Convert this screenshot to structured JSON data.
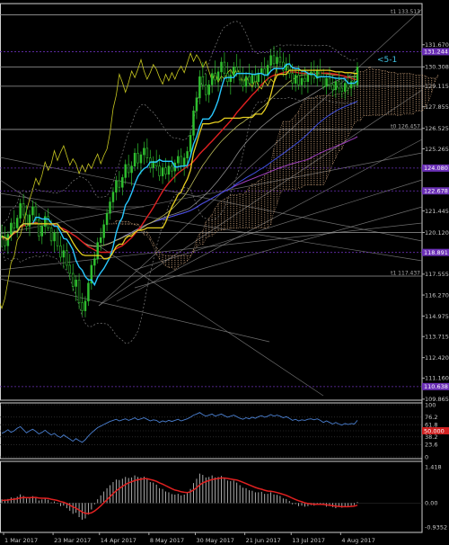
{
  "chart_data": [
    {
      "type": "candlestick",
      "panel": "price",
      "title": "",
      "ylim": [
        109.8,
        134.2
      ],
      "y_ticks": [
        131.67,
        130.308,
        129.115,
        127.855,
        126.525,
        125.265,
        124.005,
        122.775,
        121.445,
        120.12,
        118.825,
        117.555,
        116.27,
        114.975,
        113.715,
        112.42,
        111.16,
        109.865
      ],
      "highlighted_levels": [
        {
          "value": 131.244,
          "label": "131.244",
          "color": "#6a2fb5"
        },
        {
          "value": 124.08,
          "label": "124.080",
          "color": "#6a2fb5"
        },
        {
          "value": 122.678,
          "label": "122.678",
          "color": "#6a2fb5"
        },
        {
          "value": 118.891,
          "label": "118.891",
          "color": "#6a2fb5"
        },
        {
          "value": 110.638,
          "label": "110.638",
          "color": "#6a2fb5"
        }
      ],
      "level_lines": [
        {
          "value": 133.513,
          "label": "t1 133.513"
        },
        {
          "value": 126.457,
          "label": "t0 126.457"
        },
        {
          "value": 117.437,
          "label": "t1 117.437"
        },
        {
          "value": 130.308,
          "label": ""
        },
        {
          "value": 129.115,
          "label": ""
        },
        {
          "value": 120.12,
          "label": ""
        }
      ],
      "annotation": "<5-1",
      "x_labels": [
        "1 Mar 2017",
        "23 Mar 2017",
        "14 Apr 2017",
        "8 May 2017",
        "30 May 2017",
        "21 Jun 2017",
        "13 Jul 2017",
        "4 Aug 2017"
      ],
      "bar_count": 116,
      "candles_ohlc": [
        [
          119.8,
          120.6,
          119.2,
          119.9
        ],
        [
          119.9,
          120.5,
          119.0,
          119.3
        ],
        [
          119.3,
          120.2,
          118.8,
          120.0
        ],
        [
          120.0,
          121.0,
          119.6,
          120.7
        ],
        [
          120.7,
          121.5,
          120.2,
          120.4
        ],
        [
          120.4,
          121.2,
          119.8,
          121.0
        ],
        [
          121.0,
          122.2,
          120.7,
          121.9
        ],
        [
          121.9,
          122.5,
          121.0,
          121.2
        ],
        [
          121.2,
          121.8,
          120.2,
          120.5
        ],
        [
          120.5,
          121.5,
          119.9,
          121.2
        ],
        [
          121.2,
          122.1,
          120.8,
          121.7
        ],
        [
          121.7,
          122.0,
          120.6,
          120.9
        ],
        [
          120.9,
          121.3,
          119.6,
          119.9
        ],
        [
          119.9,
          120.8,
          119.4,
          120.5
        ],
        [
          120.5,
          121.4,
          120.0,
          121.1
        ],
        [
          121.1,
          121.6,
          120.2,
          120.4
        ],
        [
          120.4,
          120.9,
          119.3,
          119.6
        ],
        [
          119.6,
          120.3,
          118.9,
          120.1
        ],
        [
          120.1,
          120.6,
          119.0,
          119.3
        ],
        [
          119.3,
          119.9,
          118.3,
          118.6
        ],
        [
          118.6,
          119.4,
          117.9,
          119.0
        ],
        [
          119.0,
          119.5,
          117.8,
          118.1
        ],
        [
          118.1,
          118.8,
          117.2,
          117.6
        ],
        [
          117.6,
          118.2,
          116.5,
          116.8
        ],
        [
          116.8,
          117.5,
          115.9,
          117.2
        ],
        [
          117.2,
          117.6,
          115.4,
          115.8
        ],
        [
          115.8,
          116.4,
          115.0,
          115.3
        ],
        [
          115.3,
          116.2,
          114.9,
          115.9
        ],
        [
          115.9,
          117.3,
          115.6,
          117.0
        ],
        [
          117.0,
          118.4,
          116.6,
          118.1
        ],
        [
          118.1,
          118.9,
          117.5,
          118.5
        ],
        [
          118.5,
          119.8,
          118.2,
          119.5
        ],
        [
          119.5,
          120.4,
          119.0,
          119.8
        ],
        [
          119.8,
          120.9,
          119.3,
          120.6
        ],
        [
          120.6,
          121.6,
          120.2,
          121.3
        ],
        [
          121.3,
          122.3,
          120.9,
          122.0
        ],
        [
          122.0,
          122.9,
          121.5,
          122.6
        ],
        [
          122.6,
          123.6,
          122.1,
          123.3
        ],
        [
          123.3,
          123.9,
          122.6,
          122.9
        ],
        [
          122.9,
          123.7,
          122.4,
          123.5
        ],
        [
          123.5,
          124.6,
          123.1,
          124.3
        ],
        [
          124.3,
          124.9,
          123.5,
          123.8
        ],
        [
          123.8,
          124.5,
          123.0,
          124.2
        ],
        [
          124.2,
          125.3,
          123.9,
          125.0
        ],
        [
          125.0,
          125.6,
          124.0,
          124.4
        ],
        [
          124.4,
          125.1,
          123.7,
          124.9
        ],
        [
          124.9,
          125.7,
          124.3,
          125.3
        ],
        [
          125.3,
          125.9,
          124.4,
          124.7
        ],
        [
          124.7,
          125.2,
          123.8,
          124.1
        ],
        [
          124.1,
          124.8,
          123.5,
          124.5
        ],
        [
          124.5,
          125.2,
          123.9,
          124.2
        ],
        [
          124.2,
          124.9,
          123.3,
          123.6
        ],
        [
          123.6,
          124.4,
          123.1,
          124.1
        ],
        [
          124.1,
          124.7,
          123.4,
          123.7
        ],
        [
          123.7,
          124.5,
          123.2,
          124.2
        ],
        [
          124.2,
          124.8,
          123.5,
          123.9
        ],
        [
          123.9,
          124.6,
          123.2,
          124.4
        ],
        [
          124.4,
          125.2,
          123.9,
          124.8
        ],
        [
          124.8,
          125.3,
          123.9,
          124.2
        ],
        [
          124.2,
          125.0,
          123.6,
          124.7
        ],
        [
          124.7,
          125.4,
          124.1,
          125.1
        ],
        [
          125.1,
          126.4,
          124.8,
          126.1
        ],
        [
          126.1,
          127.9,
          125.8,
          127.6
        ],
        [
          127.6,
          128.8,
          127.1,
          128.4
        ],
        [
          128.4,
          130.1,
          128.0,
          129.7
        ],
        [
          129.7,
          130.6,
          128.9,
          129.2
        ],
        [
          129.2,
          129.9,
          128.2,
          128.6
        ],
        [
          128.6,
          129.5,
          128.1,
          129.2
        ],
        [
          129.2,
          130.2,
          128.7,
          129.9
        ],
        [
          129.9,
          130.7,
          129.2,
          129.5
        ],
        [
          129.5,
          130.3,
          128.8,
          130.0
        ],
        [
          130.0,
          130.9,
          129.4,
          130.6
        ],
        [
          130.6,
          131.2,
          129.6,
          129.9
        ],
        [
          129.9,
          130.6,
          129.1,
          129.4
        ],
        [
          129.4,
          130.2,
          128.6,
          129.8
        ],
        [
          129.8,
          130.6,
          129.3,
          130.3
        ],
        [
          130.3,
          131.1,
          129.7,
          130.0
        ],
        [
          130.0,
          130.8,
          129.2,
          129.5
        ],
        [
          129.5,
          130.3,
          128.8,
          129.1
        ],
        [
          129.1,
          130.0,
          128.7,
          129.7
        ],
        [
          129.7,
          130.5,
          129.1,
          129.3
        ],
        [
          129.3,
          130.1,
          128.8,
          129.8
        ],
        [
          129.8,
          130.4,
          129.0,
          129.4
        ],
        [
          129.4,
          130.2,
          128.8,
          129.9
        ],
        [
          129.9,
          130.6,
          129.3,
          130.2
        ],
        [
          130.2,
          130.9,
          129.5,
          129.8
        ],
        [
          129.8,
          130.7,
          129.4,
          130.4
        ],
        [
          130.4,
          131.4,
          130.0,
          131.0
        ],
        [
          131.0,
          131.6,
          130.2,
          130.5
        ],
        [
          130.5,
          131.3,
          129.9,
          130.9
        ],
        [
          130.9,
          131.5,
          130.3,
          130.6
        ],
        [
          130.6,
          131.2,
          129.7,
          130.1
        ],
        [
          130.1,
          130.9,
          129.5,
          130.5
        ],
        [
          130.5,
          131.1,
          129.6,
          129.9
        ],
        [
          129.9,
          130.5,
          128.9,
          129.3
        ],
        [
          129.3,
          130.2,
          128.8,
          129.8
        ],
        [
          129.8,
          130.4,
          128.9,
          129.2
        ],
        [
          129.2,
          130.0,
          128.6,
          129.6
        ],
        [
          129.6,
          130.3,
          129.0,
          129.4
        ],
        [
          129.4,
          130.1,
          128.7,
          129.8
        ],
        [
          129.8,
          130.6,
          129.2,
          130.0
        ],
        [
          130.0,
          130.7,
          129.3,
          129.6
        ],
        [
          129.6,
          130.4,
          129.1,
          130.1
        ],
        [
          130.1,
          130.8,
          129.4,
          129.7
        ],
        [
          129.7,
          130.2,
          128.9,
          129.1
        ],
        [
          129.1,
          129.9,
          128.6,
          129.6
        ],
        [
          129.6,
          130.3,
          128.9,
          129.2
        ],
        [
          129.2,
          129.8,
          128.5,
          128.9
        ],
        [
          128.9,
          129.7,
          128.4,
          129.4
        ],
        [
          129.4,
          130.0,
          128.7,
          129.0
        ],
        [
          129.0,
          129.6,
          128.4,
          128.8
        ],
        [
          128.8,
          129.5,
          128.3,
          129.3
        ],
        [
          129.3,
          129.9,
          128.6,
          129.0
        ],
        [
          129.0,
          129.7,
          128.5,
          129.4
        ],
        [
          129.4,
          130.0,
          128.9,
          129.2
        ],
        [
          129.2,
          130.6,
          129.0,
          130.3
        ]
      ]
    },
    {
      "type": "line",
      "panel": "oscillator",
      "ylim": [
        0,
        100
      ],
      "y_ticks": [
        100,
        76.2,
        61.8,
        50,
        38.2,
        23.6,
        0
      ],
      "current_value_label": "50.000",
      "series": [
        {
          "color": "#4a7fd0",
          "values": [
            45,
            48,
            52,
            47,
            50,
            55,
            58,
            52,
            46,
            50,
            53,
            49,
            44,
            47,
            51,
            46,
            42,
            45,
            40,
            37,
            42,
            38,
            34,
            30,
            35,
            31,
            28,
            33,
            40,
            46,
            51,
            56,
            59,
            62,
            65,
            68,
            70,
            72,
            69,
            71,
            73,
            70,
            72,
            75,
            71,
            73,
            75,
            72,
            69,
            71,
            70,
            66,
            69,
            67,
            70,
            68,
            70,
            72,
            69,
            71,
            73,
            76,
            80,
            82,
            85,
            81,
            78,
            80,
            82,
            78,
            80,
            82,
            79,
            76,
            78,
            80,
            77,
            74,
            72,
            75,
            73,
            76,
            74,
            77,
            79,
            76,
            78,
            81,
            78,
            80,
            78,
            75,
            77,
            74,
            70,
            72,
            69,
            71,
            70,
            72,
            73,
            71,
            73,
            70,
            66,
            69,
            66,
            63,
            66,
            63,
            61,
            64,
            62,
            64,
            63,
            70
          ]
        }
      ]
    },
    {
      "type": "macd",
      "panel": "histogram",
      "y_ticks": [
        1.418,
        0.0,
        -0.9352
      ],
      "histogram": [
        0.15,
        0.14,
        0.16,
        0.22,
        0.2,
        0.25,
        0.34,
        0.28,
        0.18,
        0.22,
        0.27,
        0.21,
        0.1,
        0.14,
        0.2,
        0.13,
        0.03,
        0.06,
        -0.02,
        -0.12,
        -0.1,
        -0.2,
        -0.3,
        -0.42,
        -0.38,
        -0.55,
        -0.65,
        -0.6,
        -0.45,
        -0.25,
        -0.05,
        0.15,
        0.3,
        0.45,
        0.58,
        0.7,
        0.82,
        0.92,
        0.9,
        0.95,
        1.02,
        0.98,
        1.0,
        1.08,
        1.02,
        1.0,
        1.03,
        0.95,
        0.82,
        0.8,
        0.72,
        0.58,
        0.55,
        0.45,
        0.42,
        0.35,
        0.33,
        0.36,
        0.3,
        0.33,
        0.4,
        0.55,
        0.78,
        0.95,
        1.15,
        1.1,
        1.0,
        1.02,
        1.08,
        1.0,
        1.02,
        1.06,
        0.98,
        0.88,
        0.86,
        0.88,
        0.8,
        0.7,
        0.6,
        0.58,
        0.5,
        0.48,
        0.42,
        0.42,
        0.44,
        0.36,
        0.36,
        0.42,
        0.34,
        0.32,
        0.28,
        0.18,
        0.16,
        0.08,
        -0.05,
        -0.04,
        -0.12,
        -0.1,
        -0.14,
        -0.12,
        -0.08,
        -0.1,
        -0.06,
        -0.04,
        -0.08,
        -0.14,
        -0.12,
        -0.16,
        -0.2,
        -0.14,
        -0.18,
        -0.16,
        -0.12,
        -0.1,
        -0.08,
        0.04
      ],
      "signal": [
        0.1,
        0.11,
        0.12,
        0.14,
        0.15,
        0.17,
        0.2,
        0.22,
        0.21,
        0.21,
        0.22,
        0.22,
        0.2,
        0.19,
        0.19,
        0.18,
        0.15,
        0.13,
        0.1,
        0.06,
        0.03,
        -0.02,
        -0.08,
        -0.15,
        -0.2,
        -0.27,
        -0.35,
        -0.4,
        -0.41,
        -0.38,
        -0.31,
        -0.22,
        -0.11,
        0.01,
        0.13,
        0.25,
        0.37,
        0.48,
        0.57,
        0.65,
        0.73,
        0.79,
        0.83,
        0.88,
        0.91,
        0.93,
        0.95,
        0.95,
        0.92,
        0.89,
        0.85,
        0.79,
        0.74,
        0.68,
        0.62,
        0.56,
        0.51,
        0.48,
        0.44,
        0.42,
        0.41,
        0.44,
        0.51,
        0.6,
        0.71,
        0.79,
        0.84,
        0.88,
        0.92,
        0.94,
        0.96,
        0.98,
        0.98,
        0.96,
        0.94,
        0.92,
        0.9,
        0.86,
        0.81,
        0.76,
        0.71,
        0.66,
        0.61,
        0.57,
        0.54,
        0.5,
        0.47,
        0.46,
        0.44,
        0.41,
        0.38,
        0.34,
        0.3,
        0.25,
        0.19,
        0.14,
        0.09,
        0.05,
        0.01,
        -0.02,
        -0.03,
        -0.05,
        -0.05,
        -0.05,
        -0.05,
        -0.07,
        -0.08,
        -0.1,
        -0.12,
        -0.13,
        -0.14,
        -0.14,
        -0.14,
        -0.13,
        -0.12,
        -0.08
      ]
    }
  ],
  "colors": {
    "background": "#000000",
    "grid": "#2a2a2a",
    "text": "#c8c8c8",
    "bull_candle": "#2fbf2f",
    "bear_candle": "#1a6e1a",
    "tenkan": "#28c8ff",
    "kijun": "#e8d020",
    "senkou_cloud": "#c9a07a",
    "ma_red": "#e02020",
    "ma_purple": "#a040c0",
    "ma_blue": "#4050e0",
    "chikou": "#c8c820",
    "level_box": "#6a2fb5",
    "annotation": "#40c0e0"
  }
}
